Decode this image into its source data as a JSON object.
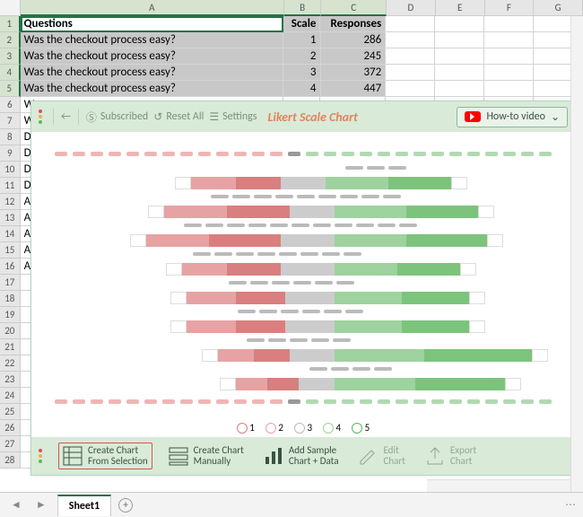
{
  "columns": [
    "A",
    "B",
    "C",
    "D",
    "E",
    "F",
    "G"
  ],
  "header_row": {
    "q": "Questions",
    "scale": "Scale",
    "resp": "Responses"
  },
  "data_rows": [
    {
      "q": "Was the checkout process easy?",
      "scale": "1",
      "resp": "286"
    },
    {
      "q": "Was the checkout process easy?",
      "scale": "2",
      "resp": "245"
    },
    {
      "q": "Was the checkout process easy?",
      "scale": "3",
      "resp": "372"
    },
    {
      "q": "Was the checkout process easy?",
      "scale": "4",
      "resp": "447"
    }
  ],
  "row_stubs": [
    "W",
    "W",
    "D",
    "D",
    "D",
    "D",
    "A",
    "A",
    "A",
    "A",
    "A"
  ],
  "panel": {
    "back": "←",
    "subscribed": "Subscribed",
    "reset": "Reset All",
    "settings": "Settings",
    "title": "Likert Scale Chart",
    "howto": "How-to video"
  },
  "legend": [
    "1",
    "2",
    "3",
    "4",
    "5"
  ],
  "footer": {
    "create_sel_l1": "Create Chart",
    "create_sel_l2": "From Selection",
    "create_man_l1": "Create Chart",
    "create_man_l2": "Manually",
    "sample_l1": "Add Sample",
    "sample_l2": "Chart + Data",
    "edit_l1": "Edit",
    "edit_l2": "Chart",
    "export_l1": "Export",
    "export_l2": "Chart"
  },
  "sheet_tab": "Sheet1"
}
